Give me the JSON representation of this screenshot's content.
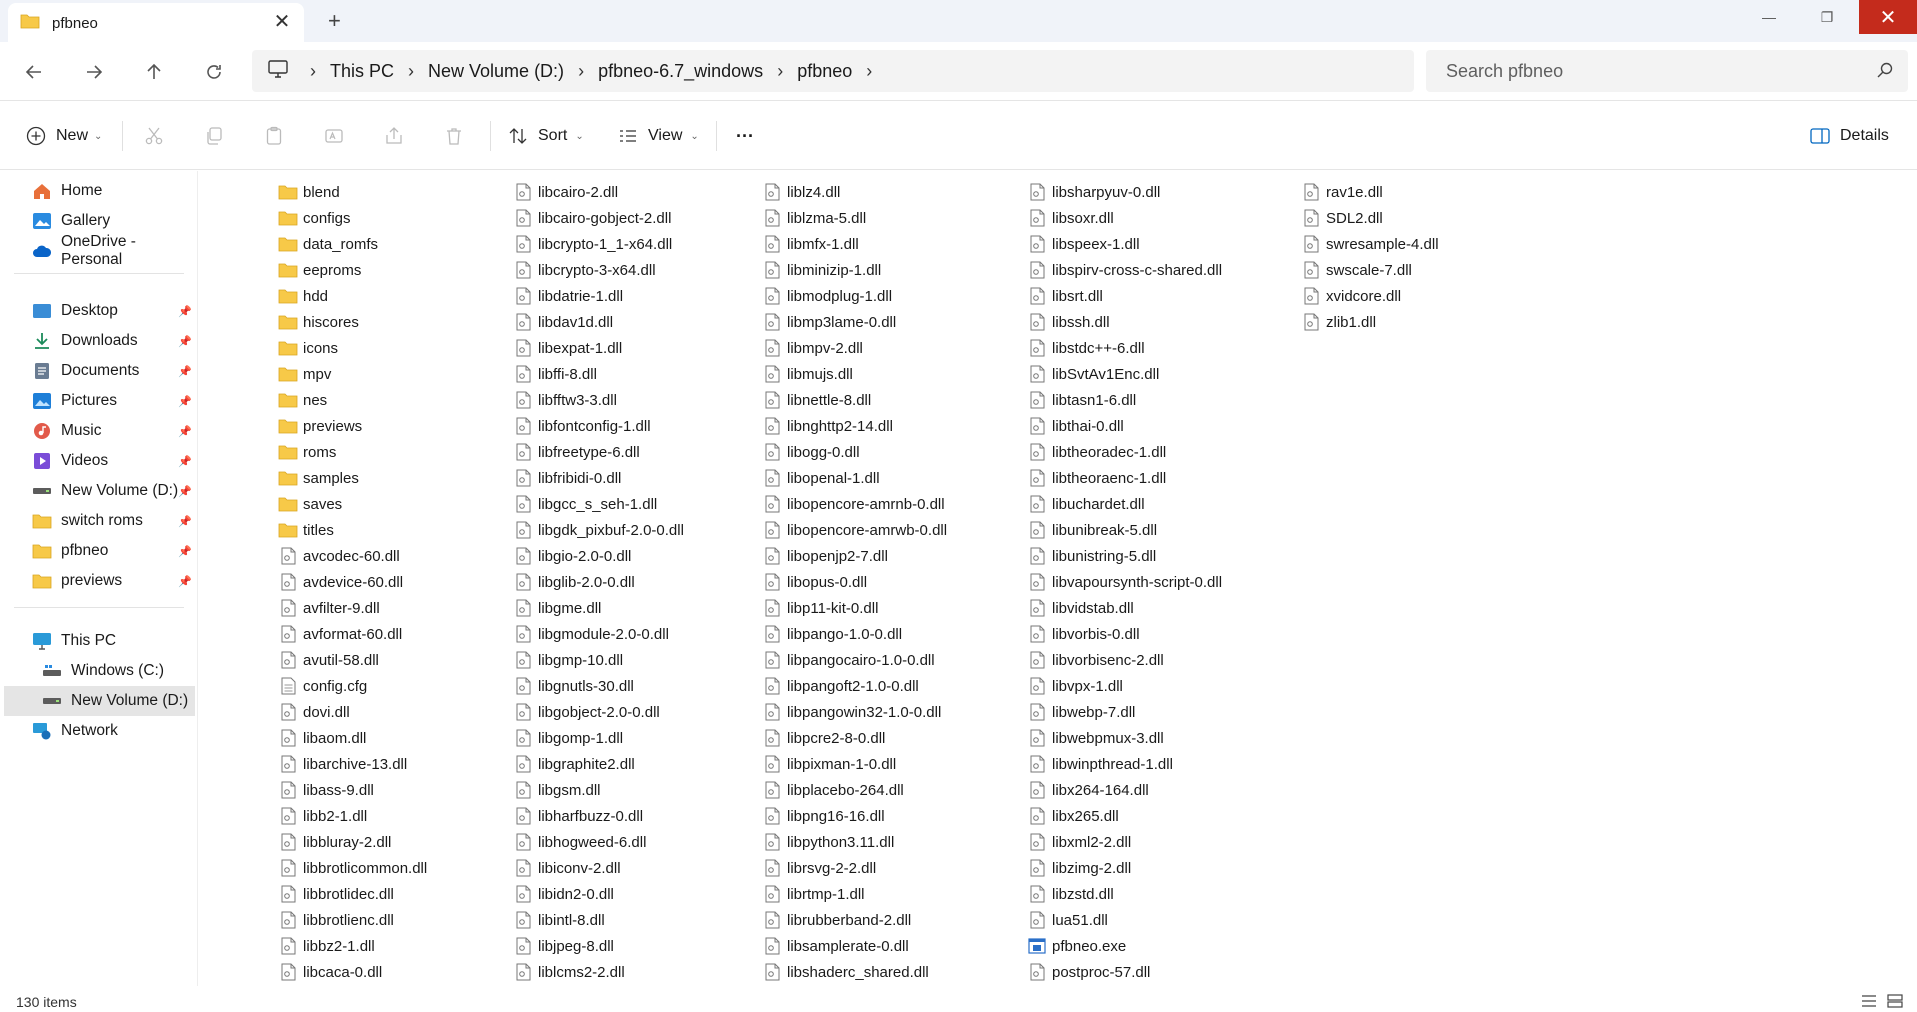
{
  "window": {
    "tab_title": "pfbneo",
    "close_tab": "✕",
    "new_tab": "+",
    "minimize": "—",
    "restore": "❐",
    "close": "✕"
  },
  "address": {
    "crumbs": [
      "This PC",
      "New Volume (D:)",
      "pfbneo-6.7_windows",
      "pfbneo"
    ],
    "separator": "›",
    "search_placeholder": "Search pfbneo"
  },
  "toolbar": {
    "new_label": "New",
    "sort_label": "Sort",
    "view_label": "View",
    "more_label": "···",
    "details_label": "Details"
  },
  "sidebar": {
    "quick": [
      {
        "label": "Home",
        "icon": "home-icon"
      },
      {
        "label": "Gallery",
        "icon": "gallery-icon"
      },
      {
        "label": "OneDrive - Personal",
        "icon": "cloud-icon"
      }
    ],
    "pinned": [
      {
        "label": "Desktop",
        "icon": "desktop-icon"
      },
      {
        "label": "Downloads",
        "icon": "download-icon"
      },
      {
        "label": "Documents",
        "icon": "documents-icon"
      },
      {
        "label": "Pictures",
        "icon": "pictures-icon"
      },
      {
        "label": "Music",
        "icon": "music-icon"
      },
      {
        "label": "Videos",
        "icon": "videos-icon"
      },
      {
        "label": "New Volume (D:)",
        "icon": "drive-icon"
      },
      {
        "label": "switch roms",
        "icon": "folder-icon"
      },
      {
        "label": "pfbneo",
        "icon": "folder-icon"
      },
      {
        "label": "previews",
        "icon": "folder-icon"
      }
    ],
    "this_pc": "This PC",
    "drives": [
      {
        "label": "Windows (C:)",
        "icon": "drive-icon"
      },
      {
        "label": "New Volume (D:)",
        "icon": "drive-icon"
      }
    ],
    "network": "Network"
  },
  "files": {
    "col1": [
      {
        "name": "blend",
        "type": "folder"
      },
      {
        "name": "configs",
        "type": "folder"
      },
      {
        "name": "data_romfs",
        "type": "folder"
      },
      {
        "name": "eeproms",
        "type": "folder"
      },
      {
        "name": "hdd",
        "type": "folder"
      },
      {
        "name": "hiscores",
        "type": "folder"
      },
      {
        "name": "icons",
        "type": "folder"
      },
      {
        "name": "mpv",
        "type": "folder"
      },
      {
        "name": "nes",
        "type": "folder"
      },
      {
        "name": "previews",
        "type": "folder"
      },
      {
        "name": "roms",
        "type": "folder"
      },
      {
        "name": "samples",
        "type": "folder"
      },
      {
        "name": "saves",
        "type": "folder"
      },
      {
        "name": "titles",
        "type": "folder"
      },
      {
        "name": "avcodec-60.dll",
        "type": "dll"
      },
      {
        "name": "avdevice-60.dll",
        "type": "dll"
      },
      {
        "name": "avfilter-9.dll",
        "type": "dll"
      },
      {
        "name": "avformat-60.dll",
        "type": "dll"
      },
      {
        "name": "avutil-58.dll",
        "type": "dll"
      },
      {
        "name": "config.cfg",
        "type": "text"
      },
      {
        "name": "dovi.dll",
        "type": "dll"
      },
      {
        "name": "libaom.dll",
        "type": "dll"
      },
      {
        "name": "libarchive-13.dll",
        "type": "dll"
      },
      {
        "name": "libass-9.dll",
        "type": "dll"
      },
      {
        "name": "libb2-1.dll",
        "type": "dll"
      },
      {
        "name": "libbluray-2.dll",
        "type": "dll"
      },
      {
        "name": "libbrotlicommon.dll",
        "type": "dll"
      },
      {
        "name": "libbrotlidec.dll",
        "type": "dll"
      },
      {
        "name": "libbrotlienc.dll",
        "type": "dll"
      },
      {
        "name": "libbz2-1.dll",
        "type": "dll"
      },
      {
        "name": "libcaca-0.dll",
        "type": "dll"
      }
    ],
    "col2": [
      {
        "name": "libcairo-2.dll",
        "type": "dll"
      },
      {
        "name": "libcairo-gobject-2.dll",
        "type": "dll"
      },
      {
        "name": "libcrypto-1_1-x64.dll",
        "type": "dll"
      },
      {
        "name": "libcrypto-3-x64.dll",
        "type": "dll"
      },
      {
        "name": "libdatrie-1.dll",
        "type": "dll"
      },
      {
        "name": "libdav1d.dll",
        "type": "dll"
      },
      {
        "name": "libexpat-1.dll",
        "type": "dll"
      },
      {
        "name": "libffi-8.dll",
        "type": "dll"
      },
      {
        "name": "libfftw3-3.dll",
        "type": "dll"
      },
      {
        "name": "libfontconfig-1.dll",
        "type": "dll"
      },
      {
        "name": "libfreetype-6.dll",
        "type": "dll"
      },
      {
        "name": "libfribidi-0.dll",
        "type": "dll"
      },
      {
        "name": "libgcc_s_seh-1.dll",
        "type": "dll"
      },
      {
        "name": "libgdk_pixbuf-2.0-0.dll",
        "type": "dll"
      },
      {
        "name": "libgio-2.0-0.dll",
        "type": "dll"
      },
      {
        "name": "libglib-2.0-0.dll",
        "type": "dll"
      },
      {
        "name": "libgme.dll",
        "type": "dll"
      },
      {
        "name": "libgmodule-2.0-0.dll",
        "type": "dll"
      },
      {
        "name": "libgmp-10.dll",
        "type": "dll"
      },
      {
        "name": "libgnutls-30.dll",
        "type": "dll"
      },
      {
        "name": "libgobject-2.0-0.dll",
        "type": "dll"
      },
      {
        "name": "libgomp-1.dll",
        "type": "dll"
      },
      {
        "name": "libgraphite2.dll",
        "type": "dll"
      },
      {
        "name": "libgsm.dll",
        "type": "dll"
      },
      {
        "name": "libharfbuzz-0.dll",
        "type": "dll"
      },
      {
        "name": "libhogweed-6.dll",
        "type": "dll"
      },
      {
        "name": "libiconv-2.dll",
        "type": "dll"
      },
      {
        "name": "libidn2-0.dll",
        "type": "dll"
      },
      {
        "name": "libintl-8.dll",
        "type": "dll"
      },
      {
        "name": "libjpeg-8.dll",
        "type": "dll"
      },
      {
        "name": "liblcms2-2.dll",
        "type": "dll"
      }
    ],
    "col3": [
      {
        "name": "liblz4.dll",
        "type": "dll"
      },
      {
        "name": "liblzma-5.dll",
        "type": "dll"
      },
      {
        "name": "libmfx-1.dll",
        "type": "dll"
      },
      {
        "name": "libminizip-1.dll",
        "type": "dll"
      },
      {
        "name": "libmodplug-1.dll",
        "type": "dll"
      },
      {
        "name": "libmp3lame-0.dll",
        "type": "dll"
      },
      {
        "name": "libmpv-2.dll",
        "type": "dll"
      },
      {
        "name": "libmujs.dll",
        "type": "dll"
      },
      {
        "name": "libnettle-8.dll",
        "type": "dll"
      },
      {
        "name": "libnghttp2-14.dll",
        "type": "dll"
      },
      {
        "name": "libogg-0.dll",
        "type": "dll"
      },
      {
        "name": "libopenal-1.dll",
        "type": "dll"
      },
      {
        "name": "libopencore-amrnb-0.dll",
        "type": "dll"
      },
      {
        "name": "libopencore-amrwb-0.dll",
        "type": "dll"
      },
      {
        "name": "libopenjp2-7.dll",
        "type": "dll"
      },
      {
        "name": "libopus-0.dll",
        "type": "dll"
      },
      {
        "name": "libp11-kit-0.dll",
        "type": "dll"
      },
      {
        "name": "libpango-1.0-0.dll",
        "type": "dll"
      },
      {
        "name": "libpangocairo-1.0-0.dll",
        "type": "dll"
      },
      {
        "name": "libpangoft2-1.0-0.dll",
        "type": "dll"
      },
      {
        "name": "libpangowin32-1.0-0.dll",
        "type": "dll"
      },
      {
        "name": "libpcre2-8-0.dll",
        "type": "dll"
      },
      {
        "name": "libpixman-1-0.dll",
        "type": "dll"
      },
      {
        "name": "libplacebo-264.dll",
        "type": "dll"
      },
      {
        "name": "libpng16-16.dll",
        "type": "dll"
      },
      {
        "name": "libpython3.11.dll",
        "type": "dll"
      },
      {
        "name": "librsvg-2-2.dll",
        "type": "dll"
      },
      {
        "name": "librtmp-1.dll",
        "type": "dll"
      },
      {
        "name": "librubberband-2.dll",
        "type": "dll"
      },
      {
        "name": "libsamplerate-0.dll",
        "type": "dll"
      },
      {
        "name": "libshaderc_shared.dll",
        "type": "dll"
      }
    ],
    "col4": [
      {
        "name": "libsharpyuv-0.dll",
        "type": "dll"
      },
      {
        "name": "libsoxr.dll",
        "type": "dll"
      },
      {
        "name": "libspeex-1.dll",
        "type": "dll"
      },
      {
        "name": "libspirv-cross-c-shared.dll",
        "type": "dll"
      },
      {
        "name": "libsrt.dll",
        "type": "dll"
      },
      {
        "name": "libssh.dll",
        "type": "dll"
      },
      {
        "name": "libstdc++-6.dll",
        "type": "dll"
      },
      {
        "name": "libSvtAv1Enc.dll",
        "type": "dll"
      },
      {
        "name": "libtasn1-6.dll",
        "type": "dll"
      },
      {
        "name": "libthai-0.dll",
        "type": "dll"
      },
      {
        "name": "libtheoradec-1.dll",
        "type": "dll"
      },
      {
        "name": "libtheoraenc-1.dll",
        "type": "dll"
      },
      {
        "name": "libuchardet.dll",
        "type": "dll"
      },
      {
        "name": "libunibreak-5.dll",
        "type": "dll"
      },
      {
        "name": "libunistring-5.dll",
        "type": "dll"
      },
      {
        "name": "libvapoursynth-script-0.dll",
        "type": "dll"
      },
      {
        "name": "libvidstab.dll",
        "type": "dll"
      },
      {
        "name": "libvorbis-0.dll",
        "type": "dll"
      },
      {
        "name": "libvorbisenc-2.dll",
        "type": "dll"
      },
      {
        "name": "libvpx-1.dll",
        "type": "dll"
      },
      {
        "name": "libwebp-7.dll",
        "type": "dll"
      },
      {
        "name": "libwebpmux-3.dll",
        "type": "dll"
      },
      {
        "name": "libwinpthread-1.dll",
        "type": "dll"
      },
      {
        "name": "libx264-164.dll",
        "type": "dll"
      },
      {
        "name": "libx265.dll",
        "type": "dll"
      },
      {
        "name": "libxml2-2.dll",
        "type": "dll"
      },
      {
        "name": "libzimg-2.dll",
        "type": "dll"
      },
      {
        "name": "libzstd.dll",
        "type": "dll"
      },
      {
        "name": "lua51.dll",
        "type": "dll"
      },
      {
        "name": "pfbneo.exe",
        "type": "exe"
      },
      {
        "name": "postproc-57.dll",
        "type": "dll"
      }
    ],
    "col5": [
      {
        "name": "rav1e.dll",
        "type": "dll"
      },
      {
        "name": "SDL2.dll",
        "type": "dll"
      },
      {
        "name": "swresample-4.dll",
        "type": "dll"
      },
      {
        "name": "swscale-7.dll",
        "type": "dll"
      },
      {
        "name": "xvidcore.dll",
        "type": "dll"
      },
      {
        "name": "zlib1.dll",
        "type": "dll"
      }
    ]
  },
  "status": {
    "item_count": "130 items"
  },
  "colors": {
    "folder": "#f7c948",
    "accent": "#0067c0",
    "close_red": "#c42b1c"
  }
}
